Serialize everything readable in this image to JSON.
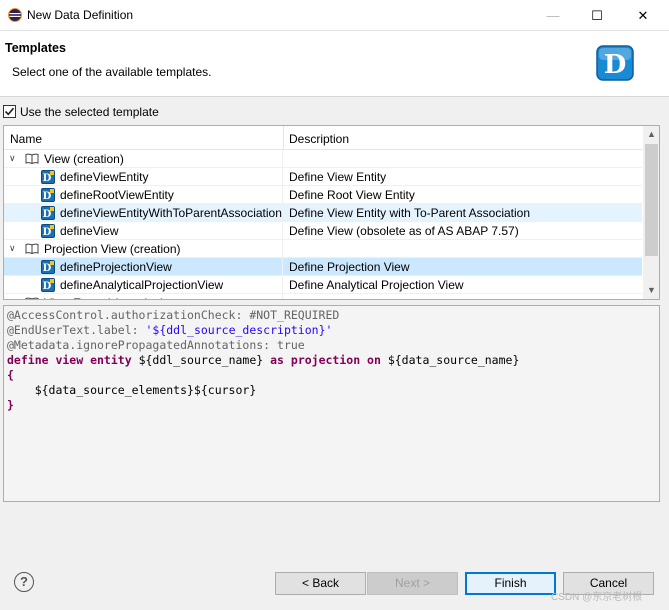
{
  "window": {
    "title": "New Data Definition",
    "minimize_glyph": "—",
    "maximize_glyph": "☐",
    "close_glyph": "✕"
  },
  "header": {
    "title": "Templates",
    "description": "Select one of the available templates.",
    "logo_letter": "D"
  },
  "use_template": {
    "label": "Use the selected template",
    "checked": true
  },
  "table": {
    "columns": [
      "Name",
      "Description"
    ],
    "rows": [
      {
        "type": "group",
        "name": "View (creation)",
        "description": "",
        "expanded": true
      },
      {
        "type": "template",
        "name": "defineViewEntity",
        "description": "Define View Entity"
      },
      {
        "type": "template",
        "name": "defineRootViewEntity",
        "description": "Define Root View Entity"
      },
      {
        "type": "template",
        "name": "defineViewEntityWithToParentAssociation",
        "description": "Define View Entity with To-Parent Association",
        "state": "hovered"
      },
      {
        "type": "template",
        "name": "defineView",
        "description": "Define View (obsolete as of AS ABAP 7.57)"
      },
      {
        "type": "group",
        "name": "Projection View (creation)",
        "description": "",
        "expanded": true
      },
      {
        "type": "template",
        "name": "defineProjectionView",
        "description": "Define Projection View",
        "state": "selected"
      },
      {
        "type": "template",
        "name": "defineAnalyticalProjectionView",
        "description": "Define Analytical Projection View"
      },
      {
        "type": "group",
        "name": "View Extend (creation)",
        "description": "",
        "expanded": false
      }
    ]
  },
  "preview": {
    "lines": [
      [
        {
          "t": "@AccessControl.authorizationCheck: #NOT_REQUIRED",
          "c": "ann"
        }
      ],
      [
        {
          "t": "@EndUserText.label: ",
          "c": "ann"
        },
        {
          "t": "'${ddl_source_description}'",
          "c": "str"
        }
      ],
      [
        {
          "t": "@Metadata.ignorePropagatedAnnotations: true",
          "c": "ann"
        }
      ],
      [
        {
          "t": "define view entity ",
          "c": "kw"
        },
        {
          "t": "${ddl_source_name} ",
          "c": "var"
        },
        {
          "t": "as projection on ",
          "c": "kw"
        },
        {
          "t": "${data_source_name}",
          "c": "var"
        }
      ],
      [
        {
          "t": "{",
          "c": "kw"
        }
      ],
      [
        {
          "t": "    ${data_source_elements}${cursor}",
          "c": "var"
        }
      ],
      [
        {
          "t": "}",
          "c": "kw"
        }
      ]
    ]
  },
  "buttons": {
    "help": "?",
    "back": "< Back",
    "next": "Next >",
    "finish": "Finish",
    "cancel": "Cancel"
  },
  "watermark": "CSDN @东京老树根",
  "colors": {
    "selection": "#cce8ff",
    "hover": "#e5f3ff",
    "keyword": "#7f0055",
    "string": "#2a00ff",
    "annotation": "#646464",
    "logo": "#1a8ad4",
    "focus_border": "#0078d7"
  },
  "icons": {
    "app": "eclipse-icon",
    "group": "book-icon",
    "template": "ddl-template-icon",
    "expand": "chevron-down-icon",
    "collapse": "chevron-right-icon"
  }
}
